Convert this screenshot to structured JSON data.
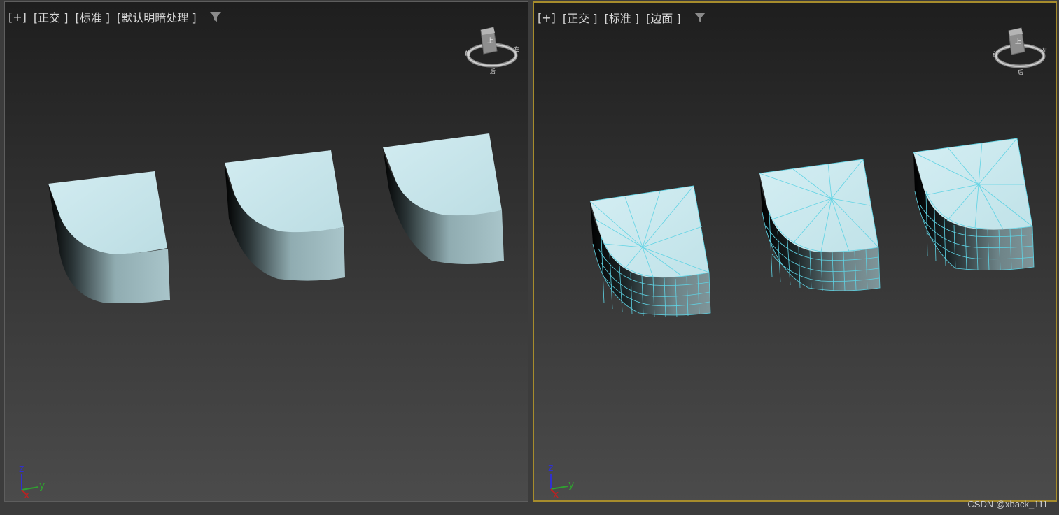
{
  "viewports": [
    {
      "labels": [
        "[+]",
        "[正交 ]",
        "[标准 ]",
        "[默认明暗处理 ]"
      ],
      "display_mode": "shaded"
    },
    {
      "labels": [
        "[+]",
        "[正交 ]",
        "[标准 ]",
        "[边面 ]"
      ],
      "display_mode": "edged-faces",
      "active": true
    }
  ],
  "viewcube_letters": {
    "top": "上",
    "west": "前",
    "east": "左",
    "south": "后"
  },
  "axis_labels": {
    "z": "z",
    "y": "y",
    "x": "x"
  },
  "colors": {
    "active_border": "#a68c2c",
    "surface": "#c5e4ea",
    "wire": "#5fd3e4",
    "axis_z": "#3030d0",
    "axis_y": "#30a030",
    "axis_x": "#c02020"
  },
  "watermark": "CSDN @xback_111"
}
